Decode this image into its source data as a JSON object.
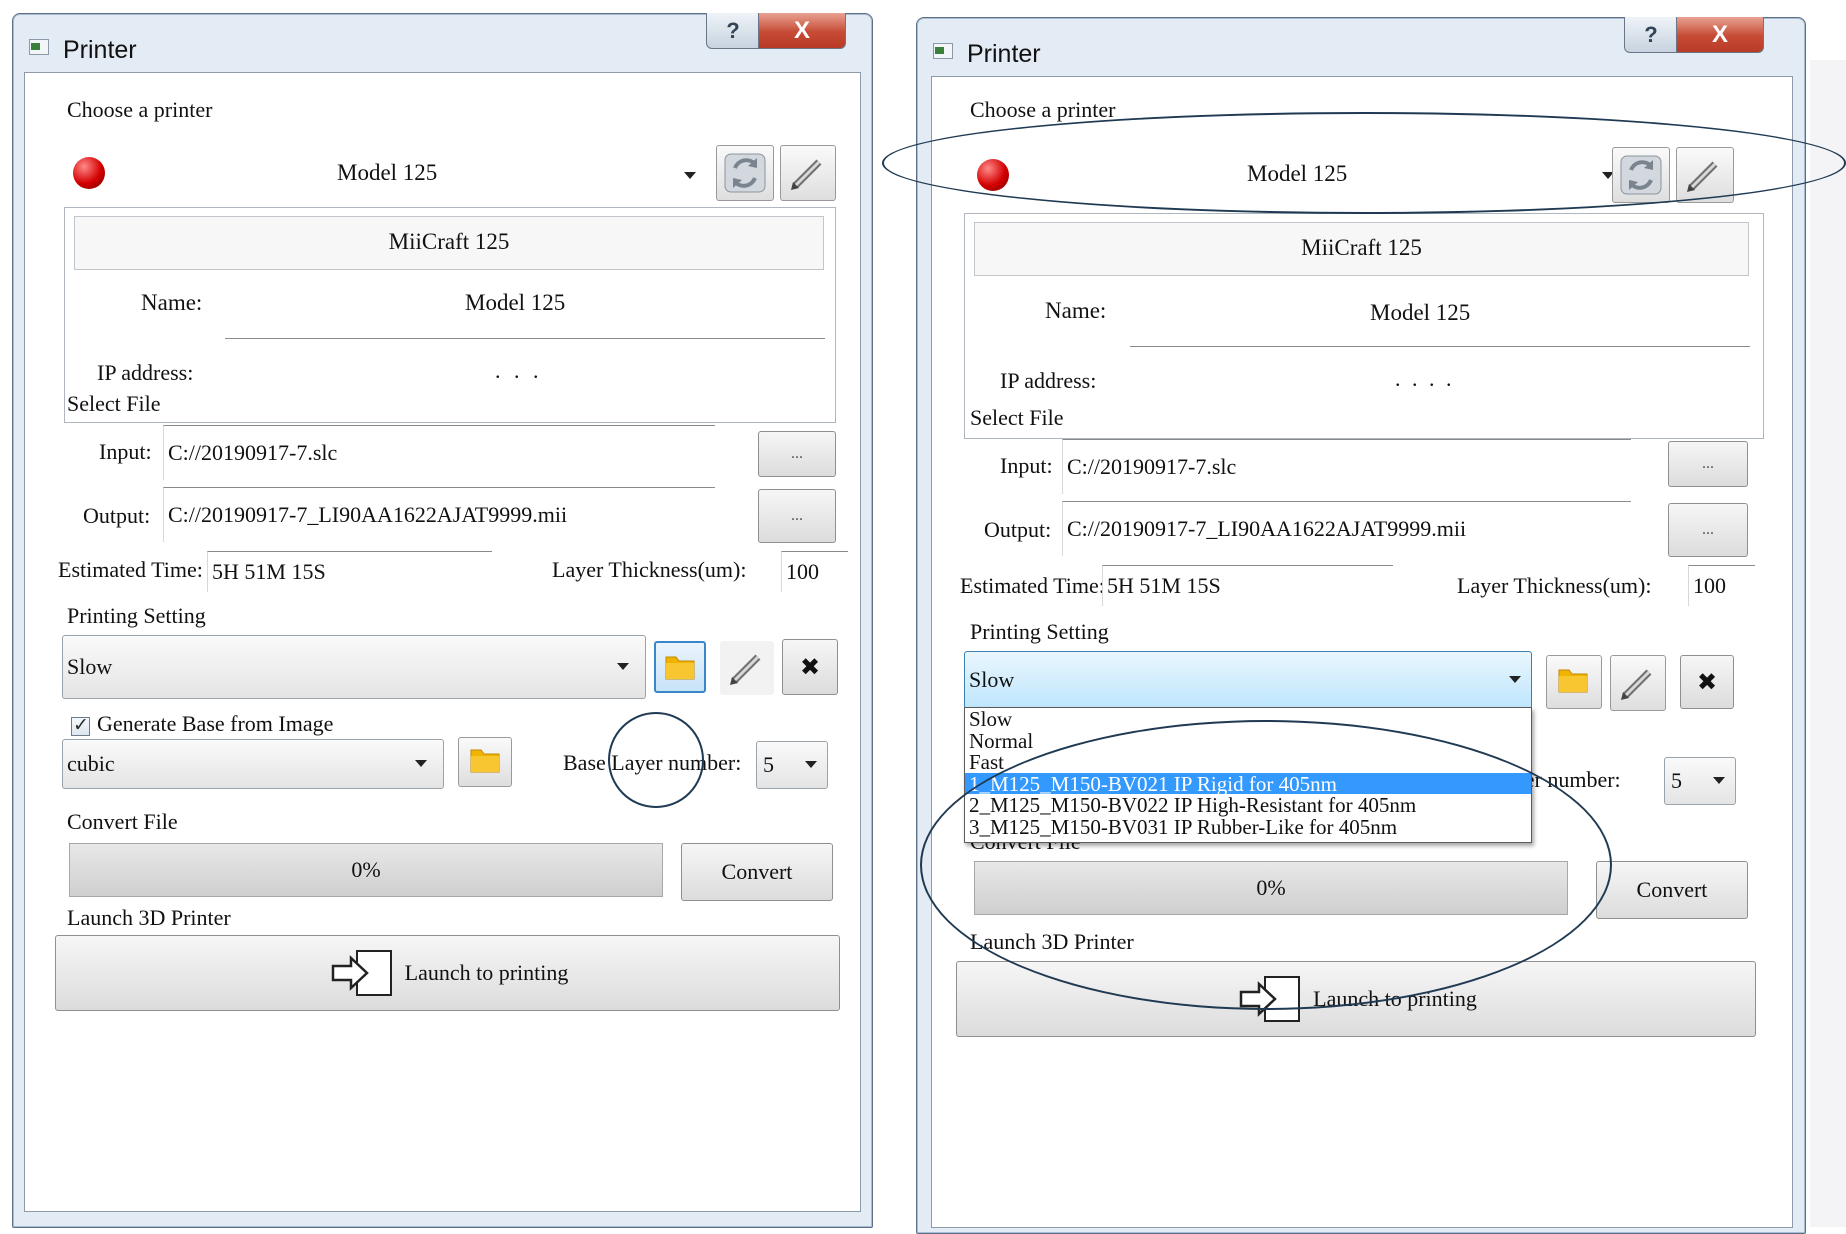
{
  "dialog_left": {
    "title": "Printer",
    "help_glyph": "?",
    "close_glyph": "X",
    "choose_printer_label": "Choose a printer",
    "printer_selected": "Model 125",
    "printer_status_color": "#cc0000",
    "printer_header": "MiiCraft 125",
    "name_label": "Name:",
    "name_value": "Model 125",
    "ip_label": "IP address:",
    "ip_value": ". . .",
    "select_file_label": "Select File",
    "input_label": "Input:",
    "input_value": "C://20190917-7.slc",
    "output_label": "Output:",
    "output_value": "C://20190917-7_LI90AA1622AJAT9999.mii",
    "browse_label": "...",
    "estimated_time_label": "Estimated Time:",
    "estimated_time_value": "5H 51M 15S",
    "layer_thickness_label": "Layer Thickness(um):",
    "layer_thickness_value": "100",
    "printing_setting_label": "Printing Setting",
    "printing_setting_value": "Slow",
    "delete_glyph": "✖",
    "generate_base_label": "Generate Base from Image",
    "generate_base_checked": "✓",
    "base_image_value": "cubic",
    "base_layer_label": "Base Layer number:",
    "base_layer_value": "5",
    "convert_file_label": "Convert File",
    "progress_text": "0%",
    "convert_button": "Convert",
    "launch_section_label": "Launch 3D Printer",
    "launch_button": "Launch to printing"
  },
  "dialog_right": {
    "title": "Printer",
    "help_glyph": "?",
    "close_glyph": "X",
    "choose_printer_label": "Choose a printer",
    "printer_selected": "Model 125",
    "printer_header": "MiiCraft 125",
    "name_label": "Name:",
    "name_value": "Model 125",
    "ip_label": "IP address:",
    "ip_value": ". . . .",
    "select_file_label": "Select File",
    "input_label": "Input:",
    "input_value": "C://20190917-7.slc",
    "output_label": "Output:",
    "output_value": "C://20190917-7_LI90AA1622AJAT9999.mii",
    "browse_label": "...",
    "estimated_time_label": "Estimated Time:",
    "estimated_time_value": "5H 51M 15S",
    "layer_thickness_label": "Layer Thickness(um):",
    "layer_thickness_value": "100",
    "printing_setting_label": "Printing Setting",
    "printing_setting_value": "Slow",
    "delete_glyph": "✖",
    "base_layer_label_partial": "ayer number:",
    "base_layer_value": "5",
    "convert_file_label_partial": "Convert File",
    "progress_text": "0%",
    "convert_button": "Convert",
    "launch_section_label": "Launch 3D Printer",
    "launch_button": "Launch to printing",
    "printing_setting_options": [
      "Slow",
      "Normal",
      "Fast",
      "1_M125_M150-BV021 IP Rigid for 405nm",
      "2_M125_M150-BV022 IP High-Resistant for 405nm",
      "3_M125_M150-BV031 IP Rubber-Like for 405nm"
    ],
    "highlighted_option_index": 3
  },
  "colors": {
    "highlight": "#3399ff",
    "annotation": "#1f3a52",
    "folder": "#f0b400"
  }
}
